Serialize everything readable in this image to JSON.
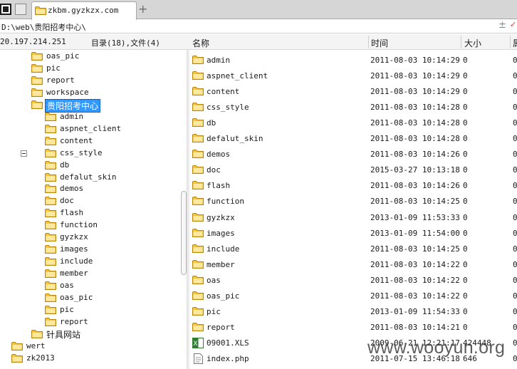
{
  "tab": {
    "title": "zkbm.gyzkzx.com",
    "add": "+"
  },
  "address": {
    "path": "D:\\web\\贵阳招考中心\\",
    "plus": "±",
    "down": "✓"
  },
  "header": {
    "ip": "20.197.214.251",
    "count": "目录(18),文件(4)",
    "columns": {
      "name": "名称",
      "time": "时间",
      "size": "大小",
      "extra": "属"
    }
  },
  "tree": [
    {
      "label": "oas_pic",
      "level": 1
    },
    {
      "label": "pic",
      "level": 1
    },
    {
      "label": "report",
      "level": 1
    },
    {
      "label": "workspace",
      "level": 1
    },
    {
      "label": "贵阳招考中心",
      "level": 1,
      "selected": true
    },
    {
      "label": "admin",
      "level": 2
    },
    {
      "label": "aspnet_client",
      "level": 2
    },
    {
      "label": "content",
      "level": 2
    },
    {
      "label": "css_style",
      "level": 2
    },
    {
      "label": "db",
      "level": 2
    },
    {
      "label": "defalut_skin",
      "level": 2
    },
    {
      "label": "demos",
      "level": 2
    },
    {
      "label": "doc",
      "level": 2
    },
    {
      "label": "flash",
      "level": 2
    },
    {
      "label": "function",
      "level": 2
    },
    {
      "label": "gyzkzx",
      "level": 2
    },
    {
      "label": "images",
      "level": 2
    },
    {
      "label": "include",
      "level": 2
    },
    {
      "label": "member",
      "level": 2
    },
    {
      "label": "oas",
      "level": 2
    },
    {
      "label": "oas_pic",
      "level": 2
    },
    {
      "label": "pic",
      "level": 2
    },
    {
      "label": "report",
      "level": 2
    },
    {
      "label": "针具网站",
      "level": 1
    },
    {
      "label": "wert",
      "level": 0
    },
    {
      "label": "zk2013",
      "level": 0
    }
  ],
  "files": [
    {
      "name": "admin",
      "time": "2011-08-03 10:14:29",
      "size": "0",
      "extra": "0",
      "type": "folder"
    },
    {
      "name": "aspnet_client",
      "time": "2011-08-03 10:14:29",
      "size": "0",
      "extra": "0",
      "type": "folder"
    },
    {
      "name": "content",
      "time": "2011-08-03 10:14:29",
      "size": "0",
      "extra": "0",
      "type": "folder"
    },
    {
      "name": "css_style",
      "time": "2011-08-03 10:14:28",
      "size": "0",
      "extra": "0",
      "type": "folder"
    },
    {
      "name": "db",
      "time": "2011-08-03 10:14:28",
      "size": "0",
      "extra": "0",
      "type": "folder"
    },
    {
      "name": "defalut_skin",
      "time": "2011-08-03 10:14:28",
      "size": "0",
      "extra": "0",
      "type": "folder"
    },
    {
      "name": "demos",
      "time": "2011-08-03 10:14:26",
      "size": "0",
      "extra": "0",
      "type": "folder"
    },
    {
      "name": "doc",
      "time": "2015-03-27 10:13:18",
      "size": "0",
      "extra": "0",
      "type": "folder"
    },
    {
      "name": "flash",
      "time": "2011-08-03 10:14:26",
      "size": "0",
      "extra": "0",
      "type": "folder"
    },
    {
      "name": "function",
      "time": "2011-08-03 10:14:25",
      "size": "0",
      "extra": "0",
      "type": "folder"
    },
    {
      "name": "gyzkzx",
      "time": "2013-01-09 11:53:33",
      "size": "0",
      "extra": "0",
      "type": "folder"
    },
    {
      "name": "images",
      "time": "2013-01-09 11:54:00",
      "size": "0",
      "extra": "0",
      "type": "folder"
    },
    {
      "name": "include",
      "time": "2011-08-03 10:14:25",
      "size": "0",
      "extra": "0",
      "type": "folder"
    },
    {
      "name": "member",
      "time": "2011-08-03 10:14:22",
      "size": "0",
      "extra": "0",
      "type": "folder"
    },
    {
      "name": "oas",
      "time": "2011-08-03 10:14:22",
      "size": "0",
      "extra": "0",
      "type": "folder"
    },
    {
      "name": "oas_pic",
      "time": "2011-08-03 10:14:22",
      "size": "0",
      "extra": "0",
      "type": "folder"
    },
    {
      "name": "pic",
      "time": "2013-01-09 11:54:33",
      "size": "0",
      "extra": "0",
      "type": "folder"
    },
    {
      "name": "report",
      "time": "2011-08-03 10:14:21",
      "size": "0",
      "extra": "0",
      "type": "folder"
    },
    {
      "name": "09001.XLS",
      "time": "2009-06-21 12:21:17",
      "size": "424448",
      "extra": "0",
      "type": "excel"
    },
    {
      "name": "index.php",
      "time": "2011-07-15 13:46:18",
      "size": "646",
      "extra": "0",
      "type": "php"
    }
  ],
  "watermark": "www.wooyun.org",
  "icons": {
    "folder": "folder-icon",
    "excel": "excel-file-icon",
    "php": "php-file-icon"
  },
  "colors": {
    "selection": "#3399ff",
    "folder": "#f5c542",
    "tabbar": "#d6d6d6"
  }
}
